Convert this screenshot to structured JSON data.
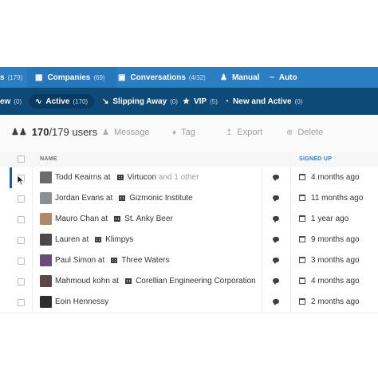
{
  "top_tabs": [
    {
      "label": "s",
      "count": "(179)"
    },
    {
      "label": "Companies",
      "count": "(69)"
    },
    {
      "label": "Conversations",
      "count": "(4/32)"
    },
    {
      "label": "Manual",
      "count": ""
    },
    {
      "label": "Auto",
      "count": ""
    }
  ],
  "filters": [
    {
      "label": "ew",
      "count": "(0)"
    },
    {
      "label": "Active",
      "count": "(170)"
    },
    {
      "label": "Slipping Away",
      "count": "(0)"
    },
    {
      "label": "VIP",
      "count": "(5)"
    },
    {
      "label": "New and Active",
      "count": "(0)"
    }
  ],
  "toolbar": {
    "count_selected": "170",
    "count_total": "/179 users",
    "message_label": "Message",
    "tag_label": "Tag",
    "export_label": "Export",
    "delete_label": "Delete"
  },
  "table": {
    "col_name": "NAME",
    "col_signed_up": "SIGNED UP",
    "rows": [
      {
        "name": "Todd Keairns at",
        "company": "Virtucon",
        "extra": "and 1 other",
        "signed": "4 months ago",
        "avatar_color": "#6b6b6b"
      },
      {
        "name": "Jordan Evans at",
        "company": "Gizmonic Institute",
        "extra": "",
        "signed": "11 months ago",
        "avatar_color": "#8a8f93"
      },
      {
        "name": "Mauro Chan at",
        "company": "St. Anky Beer",
        "extra": "",
        "signed": "1 year ago",
        "avatar_color": "#b08968"
      },
      {
        "name": "Lauren at",
        "company": "Klimpys",
        "extra": "",
        "signed": "9 months ago",
        "avatar_color": "#4a4a4a"
      },
      {
        "name": "Paul Simon at",
        "company": "Three Waters",
        "extra": "",
        "signed": "3 months ago",
        "avatar_color": "#6a4c7a"
      },
      {
        "name": "Mahmoud kohn at",
        "company": "Corellian Engineering Corporation",
        "extra": "",
        "signed": "4 months ago",
        "avatar_color": "#5a4848"
      },
      {
        "name": "Eoin Hennessy",
        "company": "",
        "extra": "",
        "signed": "2 months ago",
        "avatar_color": "#2e2e2e"
      }
    ]
  },
  "colors": {
    "topbar": "#2b7ec2",
    "filterbar": "#0e4a78",
    "accent": "#2b7ec2"
  }
}
